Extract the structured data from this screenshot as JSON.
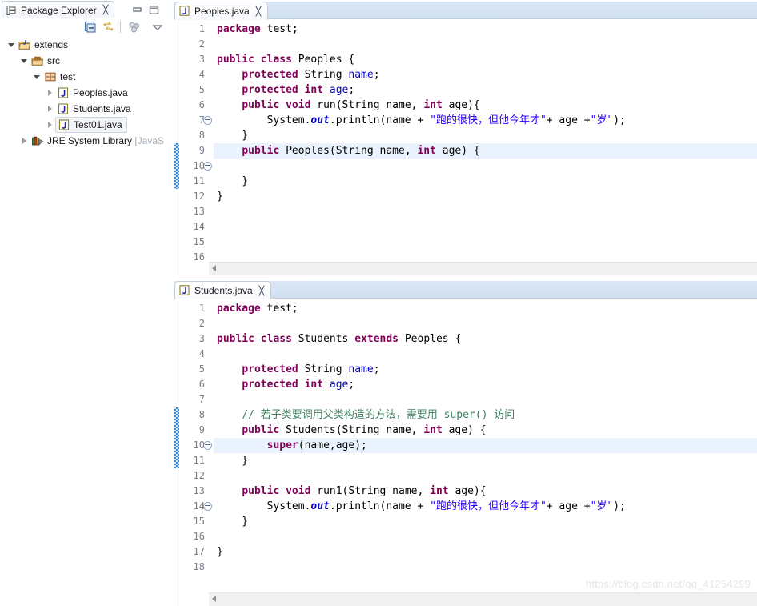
{
  "explorer": {
    "tab_label": "Package Explorer",
    "tab_close": "✕",
    "toolbar": {
      "collapse_all": "Collapse All",
      "link_with_editor": "Link with Editor",
      "focus_on_active_task": "Focus on Active Task",
      "view_menu": "View Menu"
    },
    "window": {
      "minimize": "Minimize",
      "maximize": "Maximize"
    },
    "tree": [
      {
        "label": "extends",
        "icon": "java-project-icon",
        "indent": 0,
        "state": "open",
        "selected": false,
        "dim": false
      },
      {
        "label": "src",
        "icon": "source-folder-icon",
        "indent": 1,
        "state": "open",
        "selected": false,
        "dim": false
      },
      {
        "label": "test",
        "icon": "package-icon",
        "indent": 2,
        "state": "open",
        "selected": false,
        "dim": false
      },
      {
        "label": "Peoples.java",
        "icon": "java-file-icon",
        "indent": 3,
        "state": "closed",
        "selected": false,
        "dim": false
      },
      {
        "label": "Students.java",
        "icon": "java-file-icon",
        "indent": 3,
        "state": "closed",
        "selected": false,
        "dim": false
      },
      {
        "label": "Test01.java",
        "icon": "java-file-icon",
        "indent": 3,
        "state": "closed",
        "selected": true,
        "dim": false
      },
      {
        "label": "JRE System Library [JavaS",
        "icon": "jre-library-icon",
        "indent": 1,
        "state": "closed",
        "selected": false,
        "dim": false
      }
    ]
  },
  "editors": [
    {
      "tab_label": "Peoples.java",
      "tab_close": "✕",
      "tab_icon": "java-file-icon",
      "total_lines": 16,
      "current_line": 9,
      "change_bar_lines": [
        9,
        10,
        11
      ],
      "fold_lines": [
        6,
        9
      ],
      "lines": [
        {
          "n": 1,
          "tokens": [
            {
              "t": "package",
              "c": "kw"
            },
            {
              "t": " test;",
              "c": ""
            }
          ]
        },
        {
          "n": 2,
          "tokens": []
        },
        {
          "n": 3,
          "tokens": [
            {
              "t": "public",
              "c": "kw"
            },
            {
              "t": " ",
              "c": ""
            },
            {
              "t": "class",
              "c": "kw"
            },
            {
              "t": " Peoples {",
              "c": ""
            }
          ]
        },
        {
          "n": 4,
          "tokens": [
            {
              "t": "    ",
              "c": ""
            },
            {
              "t": "protected",
              "c": "kw"
            },
            {
              "t": " String ",
              "c": ""
            },
            {
              "t": "name",
              "c": "fld"
            },
            {
              "t": ";",
              "c": ""
            }
          ]
        },
        {
          "n": 5,
          "tokens": [
            {
              "t": "    ",
              "c": ""
            },
            {
              "t": "protected",
              "c": "kw"
            },
            {
              "t": " ",
              "c": ""
            },
            {
              "t": "int",
              "c": "kw"
            },
            {
              "t": " ",
              "c": ""
            },
            {
              "t": "age",
              "c": "fld"
            },
            {
              "t": ";",
              "c": ""
            }
          ]
        },
        {
          "n": 6,
          "tokens": [
            {
              "t": "    ",
              "c": ""
            },
            {
              "t": "public",
              "c": "kw"
            },
            {
              "t": " ",
              "c": ""
            },
            {
              "t": "void",
              "c": "kw"
            },
            {
              "t": " run(String name, ",
              "c": ""
            },
            {
              "t": "int",
              "c": "kw"
            },
            {
              "t": " age){",
              "c": ""
            }
          ]
        },
        {
          "n": 7,
          "tokens": [
            {
              "t": "        System.",
              "c": ""
            },
            {
              "t": "out",
              "c": "stat"
            },
            {
              "t": ".println(name + ",
              "c": ""
            },
            {
              "t": "\"跑的很快，但他今年才\"",
              "c": "str"
            },
            {
              "t": "+ age +",
              "c": ""
            },
            {
              "t": "\"岁\"",
              "c": "str"
            },
            {
              "t": ");",
              "c": ""
            }
          ]
        },
        {
          "n": 8,
          "tokens": [
            {
              "t": "    }",
              "c": ""
            }
          ]
        },
        {
          "n": 9,
          "tokens": [
            {
              "t": "    ",
              "c": ""
            },
            {
              "t": "public",
              "c": "kw"
            },
            {
              "t": " Peoples(String name, ",
              "c": ""
            },
            {
              "t": "int",
              "c": "kw"
            },
            {
              "t": " age) {",
              "c": ""
            }
          ]
        },
        {
          "n": 10,
          "tokens": []
        },
        {
          "n": 11,
          "tokens": [
            {
              "t": "    }",
              "c": ""
            }
          ]
        },
        {
          "n": 12,
          "tokens": [
            {
              "t": "}",
              "c": ""
            }
          ]
        },
        {
          "n": 13,
          "tokens": []
        },
        {
          "n": 14,
          "tokens": []
        },
        {
          "n": 15,
          "tokens": []
        },
        {
          "n": 16,
          "tokens": []
        }
      ]
    },
    {
      "tab_label": "Students.java",
      "tab_close": "✕",
      "tab_icon": "java-file-icon",
      "total_lines": 18,
      "current_line": 10,
      "change_bar_lines": [
        8,
        9,
        10,
        11
      ],
      "fold_lines": [
        9,
        13
      ],
      "lines": [
        {
          "n": 1,
          "tokens": [
            {
              "t": "package",
              "c": "kw"
            },
            {
              "t": " test;",
              "c": ""
            }
          ]
        },
        {
          "n": 2,
          "tokens": []
        },
        {
          "n": 3,
          "tokens": [
            {
              "t": "public",
              "c": "kw"
            },
            {
              "t": " ",
              "c": ""
            },
            {
              "t": "class",
              "c": "kw"
            },
            {
              "t": " Students ",
              "c": ""
            },
            {
              "t": "extends",
              "c": "kw"
            },
            {
              "t": " Peoples {",
              "c": ""
            }
          ]
        },
        {
          "n": 4,
          "tokens": []
        },
        {
          "n": 5,
          "tokens": [
            {
              "t": "    ",
              "c": ""
            },
            {
              "t": "protected",
              "c": "kw"
            },
            {
              "t": " String ",
              "c": ""
            },
            {
              "t": "name",
              "c": "fld"
            },
            {
              "t": ";",
              "c": ""
            }
          ]
        },
        {
          "n": 6,
          "tokens": [
            {
              "t": "    ",
              "c": ""
            },
            {
              "t": "protected",
              "c": "kw"
            },
            {
              "t": " ",
              "c": ""
            },
            {
              "t": "int",
              "c": "kw"
            },
            {
              "t": " ",
              "c": ""
            },
            {
              "t": "age",
              "c": "fld"
            },
            {
              "t": ";",
              "c": ""
            }
          ]
        },
        {
          "n": 7,
          "tokens": []
        },
        {
          "n": 8,
          "tokens": [
            {
              "t": "    ",
              "c": ""
            },
            {
              "t": "// 若子类要调用父类构造的方法，需要用 super() 访问",
              "c": "cmt"
            }
          ]
        },
        {
          "n": 9,
          "tokens": [
            {
              "t": "    ",
              "c": ""
            },
            {
              "t": "public",
              "c": "kw"
            },
            {
              "t": " Students(String name, ",
              "c": ""
            },
            {
              "t": "int",
              "c": "kw"
            },
            {
              "t": " age) {",
              "c": ""
            }
          ]
        },
        {
          "n": 10,
          "tokens": [
            {
              "t": "        ",
              "c": ""
            },
            {
              "t": "super",
              "c": "kw"
            },
            {
              "t": "(name,age);",
              "c": ""
            }
          ]
        },
        {
          "n": 11,
          "tokens": [
            {
              "t": "    }",
              "c": ""
            }
          ]
        },
        {
          "n": 12,
          "tokens": []
        },
        {
          "n": 13,
          "tokens": [
            {
              "t": "    ",
              "c": ""
            },
            {
              "t": "public",
              "c": "kw"
            },
            {
              "t": " ",
              "c": ""
            },
            {
              "t": "void",
              "c": "kw"
            },
            {
              "t": " run1(String name, ",
              "c": ""
            },
            {
              "t": "int",
              "c": "kw"
            },
            {
              "t": " age){",
              "c": ""
            }
          ]
        },
        {
          "n": 14,
          "tokens": [
            {
              "t": "        System.",
              "c": ""
            },
            {
              "t": "out",
              "c": "stat"
            },
            {
              "t": ".println(name + ",
              "c": ""
            },
            {
              "t": "\"跑的很快，但他今年才\"",
              "c": "str"
            },
            {
              "t": "+ age +",
              "c": ""
            },
            {
              "t": "\"岁\"",
              "c": "str"
            },
            {
              "t": ");",
              "c": ""
            }
          ]
        },
        {
          "n": 15,
          "tokens": [
            {
              "t": "    }",
              "c": ""
            }
          ]
        },
        {
          "n": 16,
          "tokens": []
        },
        {
          "n": 17,
          "tokens": [
            {
              "t": "}",
              "c": ""
            }
          ]
        },
        {
          "n": 18,
          "tokens": []
        }
      ]
    }
  ],
  "watermark": "https://blog.csdn.net/qq_41254299",
  "colors": {
    "keyword": "#7F0055",
    "field": "#0000C0",
    "string": "#2A00FF",
    "comment": "#3F7F5F",
    "current_line_highlight": "#E9F2FD",
    "change_bar": "#3A8FDB",
    "tab_active_bg": "#FFFFFF",
    "tab_strip_bg": "#D4E2F2"
  }
}
